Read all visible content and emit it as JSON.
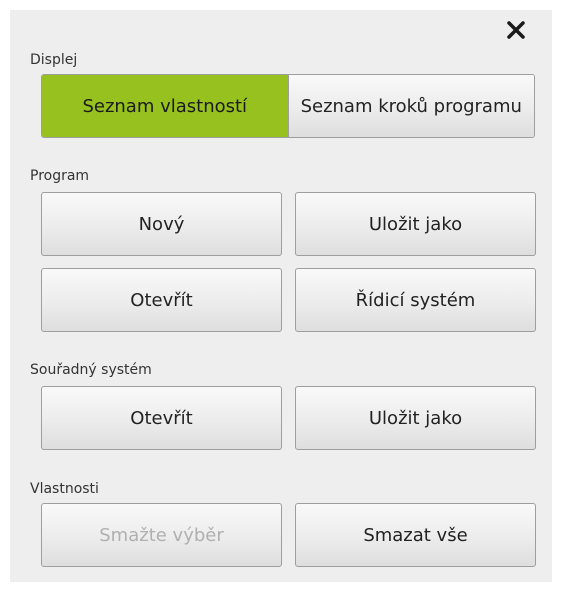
{
  "close": {
    "icon": "close-icon"
  },
  "display": {
    "label": "Displej",
    "options": [
      {
        "label": "Seznam vlastností",
        "active": true
      },
      {
        "label": "Seznam kroků programu",
        "active": false
      }
    ],
    "active_color": "#97c11f"
  },
  "program": {
    "label": "Program",
    "new_label": "Nový",
    "save_as_label": "Uložit jako",
    "open_label": "Otevřít",
    "control_system_label": "Řídicí systém"
  },
  "coordinate_system": {
    "label": "Souřadný systém",
    "open_label": "Otevřít",
    "save_as_label": "Uložit jako"
  },
  "properties": {
    "label": "Vlastnosti",
    "delete_selection_label": "Smažte výběr",
    "delete_selection_enabled": false,
    "delete_all_label": "Smazat vše"
  }
}
